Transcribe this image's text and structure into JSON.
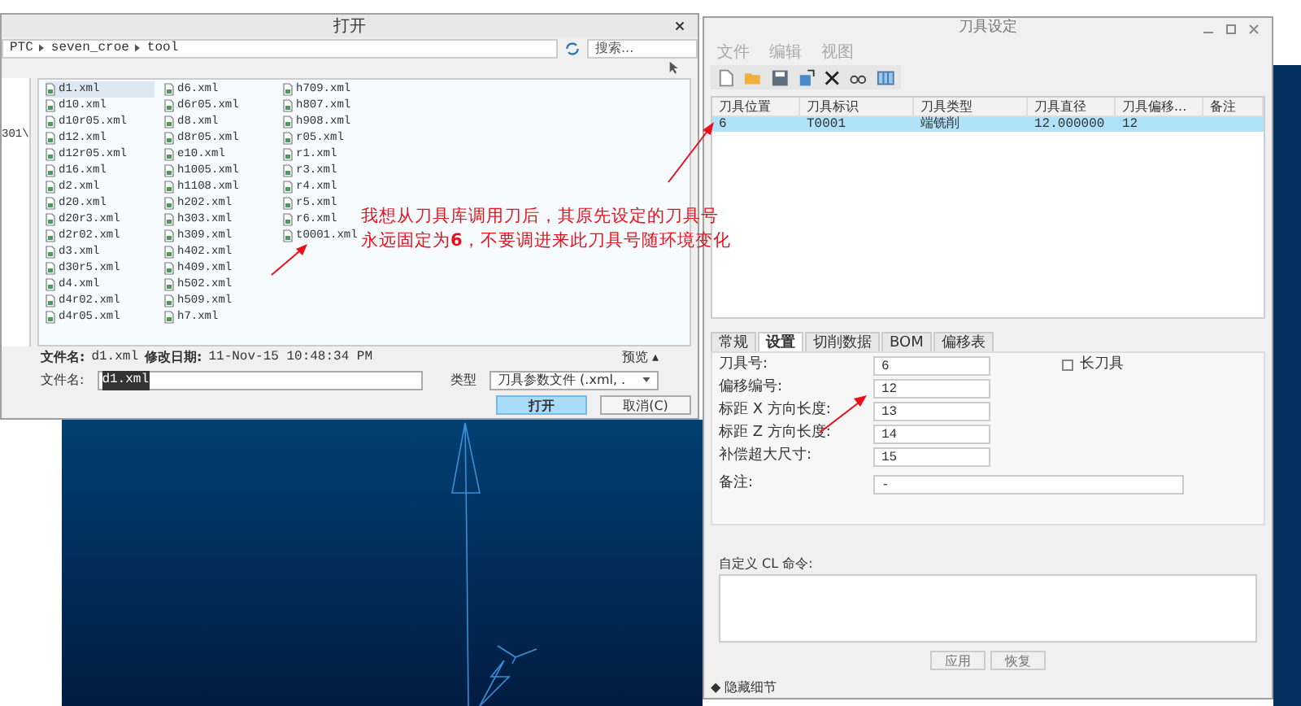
{
  "open_dialog": {
    "title": "打开",
    "path": [
      "PTC",
      "seven_croe",
      "tool"
    ],
    "search": {
      "placeholder": "搜索..."
    },
    "nav_text": "301\\",
    "files": [
      [
        {
          "name": "d1.xml",
          "selected": true
        },
        {
          "name": "d10.xml",
          "selected": false
        },
        {
          "name": "d10r05.xml",
          "selected": false
        },
        {
          "name": "d12.xml",
          "selected": false
        },
        {
          "name": "d12r05.xml",
          "selected": false
        },
        {
          "name": "d16.xml",
          "selected": false
        },
        {
          "name": "d2.xml",
          "selected": false
        },
        {
          "name": "d20.xml",
          "selected": false
        },
        {
          "name": "d20r3.xml",
          "selected": false
        },
        {
          "name": "d2r02.xml",
          "selected": false
        },
        {
          "name": "d3.xml",
          "selected": false
        },
        {
          "name": "d30r5.xml",
          "selected": false
        },
        {
          "name": "d4.xml",
          "selected": false
        },
        {
          "name": "d4r02.xml",
          "selected": false
        },
        {
          "name": "d4r05.xml",
          "selected": false
        }
      ],
      [
        {
          "name": "d6.xml",
          "selected": false
        },
        {
          "name": "d6r05.xml",
          "selected": false
        },
        {
          "name": "d8.xml",
          "selected": false
        },
        {
          "name": "d8r05.xml",
          "selected": false
        },
        {
          "name": "e10.xml",
          "selected": false
        },
        {
          "name": "h1005.xml",
          "selected": false
        },
        {
          "name": "h1108.xml",
          "selected": false
        },
        {
          "name": "h202.xml",
          "selected": false
        },
        {
          "name": "h303.xml",
          "selected": false
        },
        {
          "name": "h309.xml",
          "selected": false
        },
        {
          "name": "h402.xml",
          "selected": false
        },
        {
          "name": "h409.xml",
          "selected": false
        },
        {
          "name": "h502.xml",
          "selected": false
        },
        {
          "name": "h509.xml",
          "selected": false
        },
        {
          "name": "h7.xml",
          "selected": false
        }
      ],
      [
        {
          "name": "h709.xml",
          "selected": false
        },
        {
          "name": "h807.xml",
          "selected": false
        },
        {
          "name": "h908.xml",
          "selected": false
        },
        {
          "name": "r05.xml",
          "selected": false
        },
        {
          "name": "r1.xml",
          "selected": false
        },
        {
          "name": "r3.xml",
          "selected": false
        },
        {
          "name": "r4.xml",
          "selected": false
        },
        {
          "name": "r5.xml",
          "selected": false
        },
        {
          "name": "r6.xml",
          "selected": false
        },
        {
          "name": "t0001.xml",
          "selected": false
        }
      ]
    ],
    "info": {
      "name_label": "文件名:",
      "name": "d1.xml",
      "date_label": "修改日期:",
      "date": "11-Nov-15 10:48:34 PM",
      "preview": "预览 ▴"
    },
    "filename": {
      "label": "文件名:",
      "value": "d1.xml"
    },
    "type": {
      "label": "类型",
      "value": "刀具参数文件 (.xml, ."
    },
    "buttons": [
      {
        "label": "打开",
        "primary": true
      },
      {
        "label": "取消(C)",
        "primary": false
      }
    ]
  },
  "annotation": {
    "lines": [
      "我想从刀具库调用刀后，其原先设定的刀具号",
      "永远固定为**6**，不要调进来此刀具号随环境变化"
    ]
  },
  "tool_dialog": {
    "title": "刀具设定",
    "menu": [
      {
        "label": "文件",
        "disabled": true
      },
      {
        "label": "编辑",
        "disabled": true
      },
      {
        "label": "视图",
        "disabled": true
      }
    ],
    "table": {
      "columns": [
        "刀具位置",
        "刀具标识",
        "刀具类型",
        "刀具直径",
        "刀具偏移...",
        "备注"
      ],
      "rows": [
        {
          "cells": [
            "6",
            "T0001",
            "端铣削",
            "12.000000",
            "12",
            ""
          ],
          "selected": true
        }
      ]
    },
    "tabs": [
      {
        "label": "常规",
        "selected": false
      },
      {
        "label": "设置",
        "selected": true
      },
      {
        "label": "切削数据",
        "selected": false
      },
      {
        "label": "BOM",
        "selected": false
      },
      {
        "label": "偏移表",
        "selected": false
      }
    ],
    "fields": [
      {
        "label": "刀具号:",
        "value": "6"
      },
      {
        "label": "偏移编号:",
        "value": "12"
      },
      {
        "label": "标距 X 方向长度:",
        "value": "13"
      },
      {
        "label": "标距 Z 方向长度:",
        "value": "14"
      },
      {
        "label": "补偿超大尺寸:",
        "value": "15"
      }
    ],
    "long_tool": {
      "label": "长刀具",
      "checked": false
    },
    "note": {
      "label": "备注:",
      "value": "-"
    },
    "cl_label": "自定义 CL 命令:",
    "actions": [
      "应用",
      "恢复"
    ],
    "hide_details": "◆ 隐藏细节"
  }
}
